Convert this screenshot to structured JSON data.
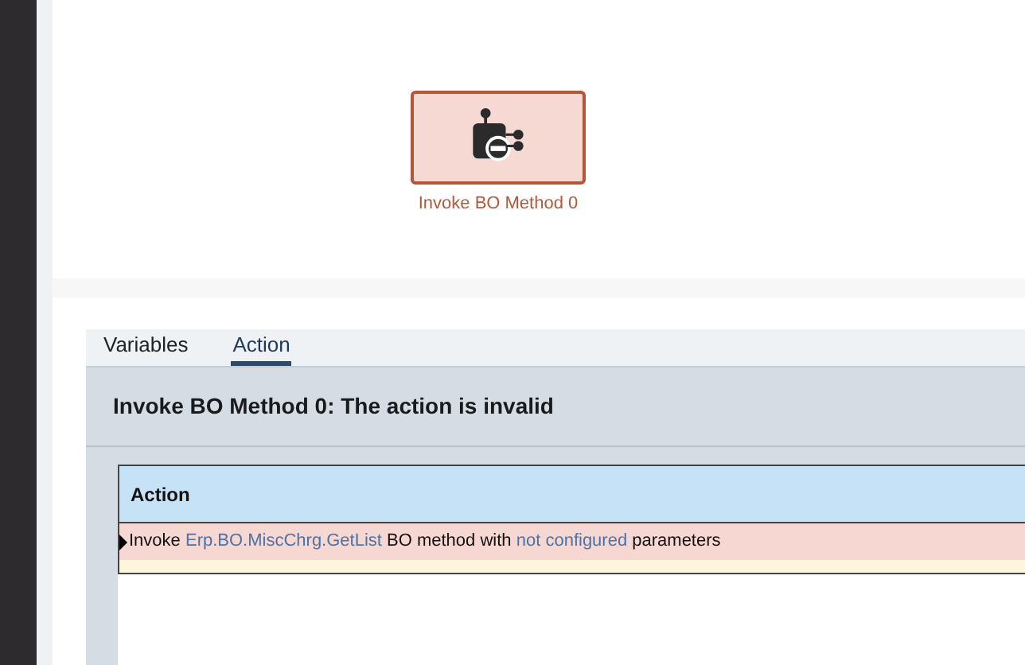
{
  "canvas": {
    "node": {
      "label": "Invoke BO Method 0",
      "invalid": true
    }
  },
  "tabs": [
    {
      "label": "Variables",
      "selected": false
    },
    {
      "label": "Action",
      "selected": true
    }
  ],
  "panel": {
    "title": "Invoke BO Method 0: The action is invalid",
    "table": {
      "columns": [
        "Action"
      ],
      "rows": [
        {
          "current": true,
          "invalid": true,
          "parts": [
            {
              "kind": "text",
              "text": "Invoke"
            },
            {
              "kind": "link",
              "text": "Erp.BO.MiscChrg.GetList"
            },
            {
              "kind": "text",
              "text": "BO method with"
            },
            {
              "kind": "link",
              "text": "not configured"
            },
            {
              "kind": "text",
              "text": "parameters"
            }
          ]
        }
      ]
    }
  }
}
